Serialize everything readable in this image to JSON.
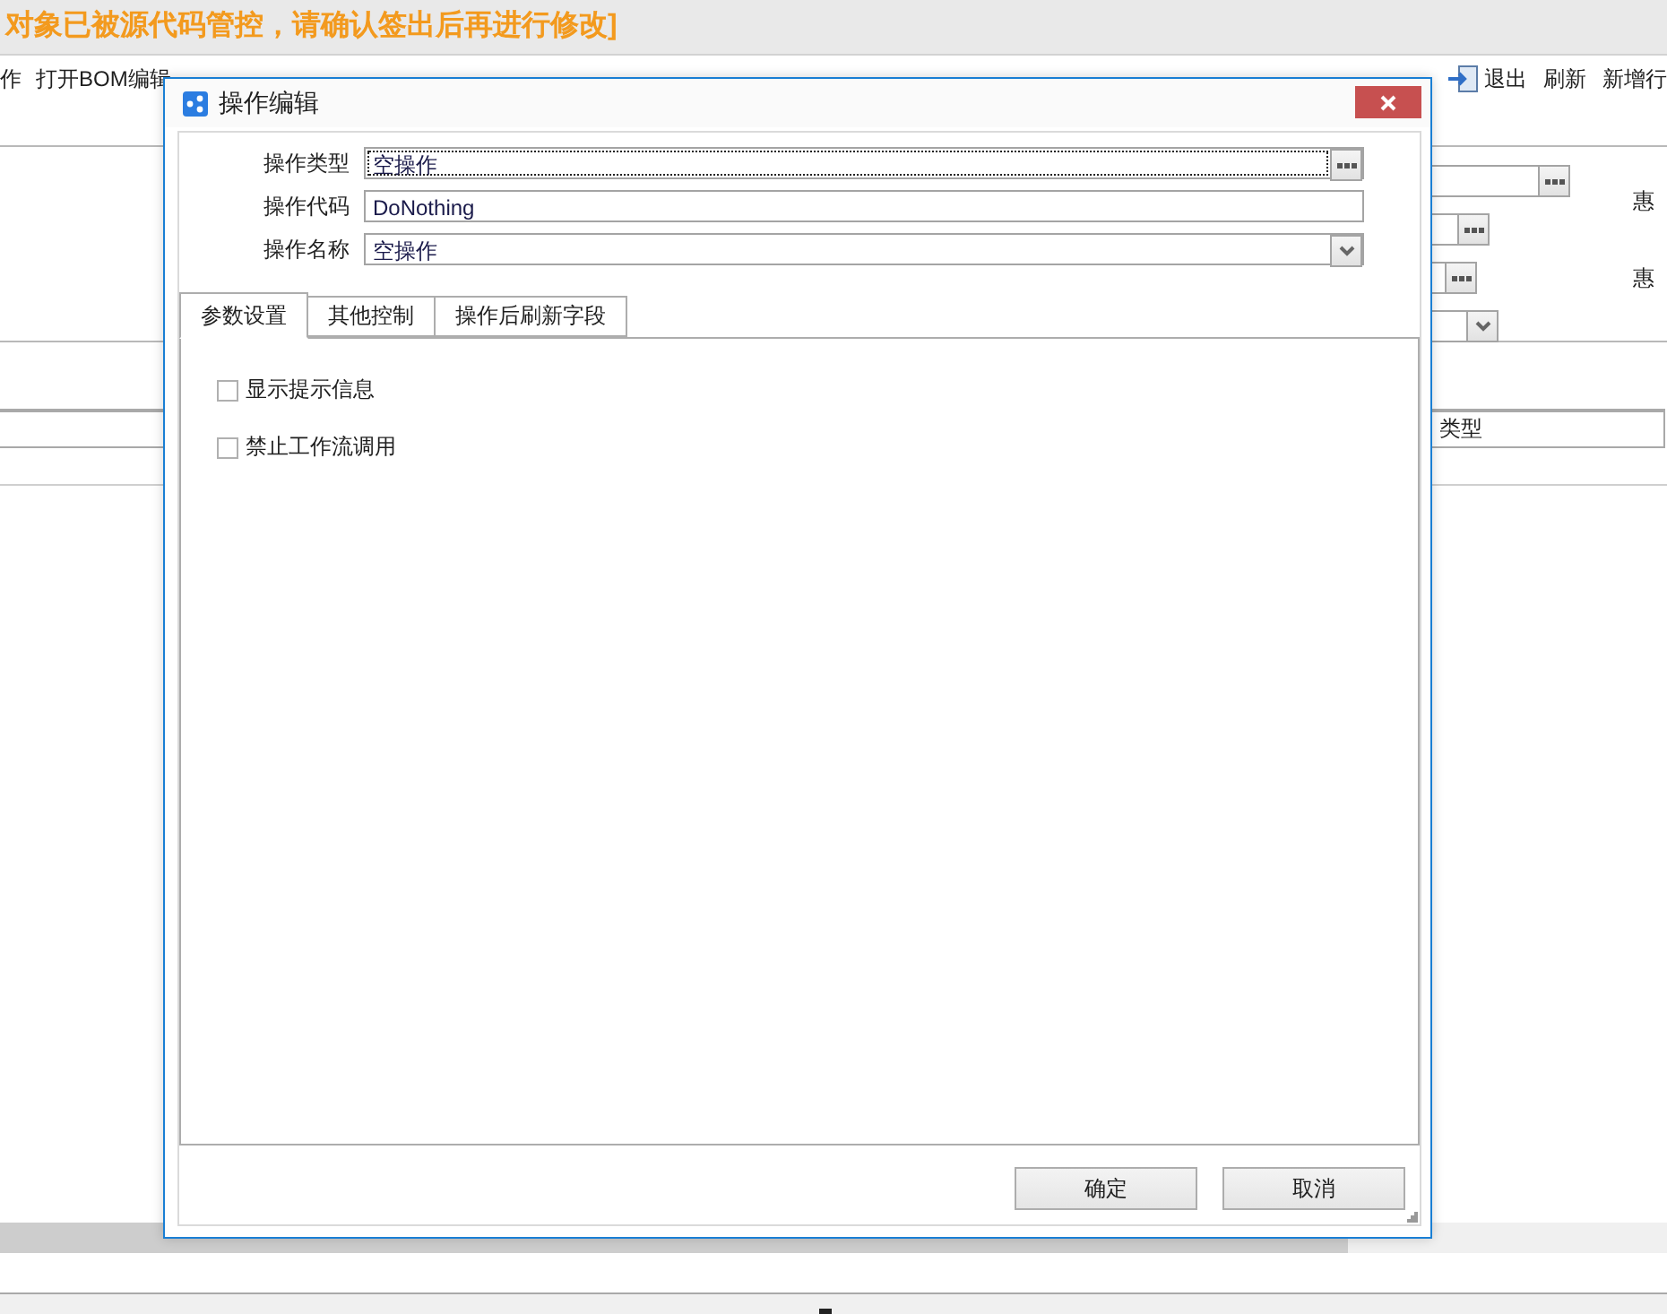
{
  "notice": "对象已被源代码管控，请确认签出后再进行修改]",
  "toolbar": {
    "left_items": [
      "作",
      "打开BOM编辑"
    ],
    "right_items": [
      {
        "label": "退出",
        "kind": "icon"
      },
      {
        "label": "刷新",
        "kind": "text"
      },
      {
        "label": "新增行",
        "kind": "text"
      }
    ]
  },
  "form_rows": [
    {
      "kind": "browse",
      "side_label": "惠"
    },
    {
      "kind": "browse"
    },
    {
      "kind": "browse",
      "side_label": "惠"
    },
    {
      "kind": "dropdown"
    }
  ],
  "table": {
    "columns": [
      {
        "label": "类型"
      }
    ]
  },
  "dialog": {
    "title": "操作编辑",
    "fields": [
      {
        "label": "操作类型",
        "value": "空操作",
        "kind": "browse",
        "focused": true
      },
      {
        "label": "操作代码",
        "value": "DoNothing",
        "kind": "text",
        "focused": false
      },
      {
        "label": "操作名称",
        "value": "空操作",
        "kind": "dropdown",
        "focused": false
      }
    ],
    "tabs": [
      {
        "label": "参数设置",
        "selected": true
      },
      {
        "label": "其他控制",
        "selected": false
      },
      {
        "label": "操作后刷新字段",
        "selected": false
      }
    ],
    "options": [
      {
        "label": "显示提示信息",
        "checked": false
      },
      {
        "label": "禁止工作流调用",
        "checked": false
      }
    ],
    "buttons": [
      "确定",
      "取消"
    ]
  }
}
